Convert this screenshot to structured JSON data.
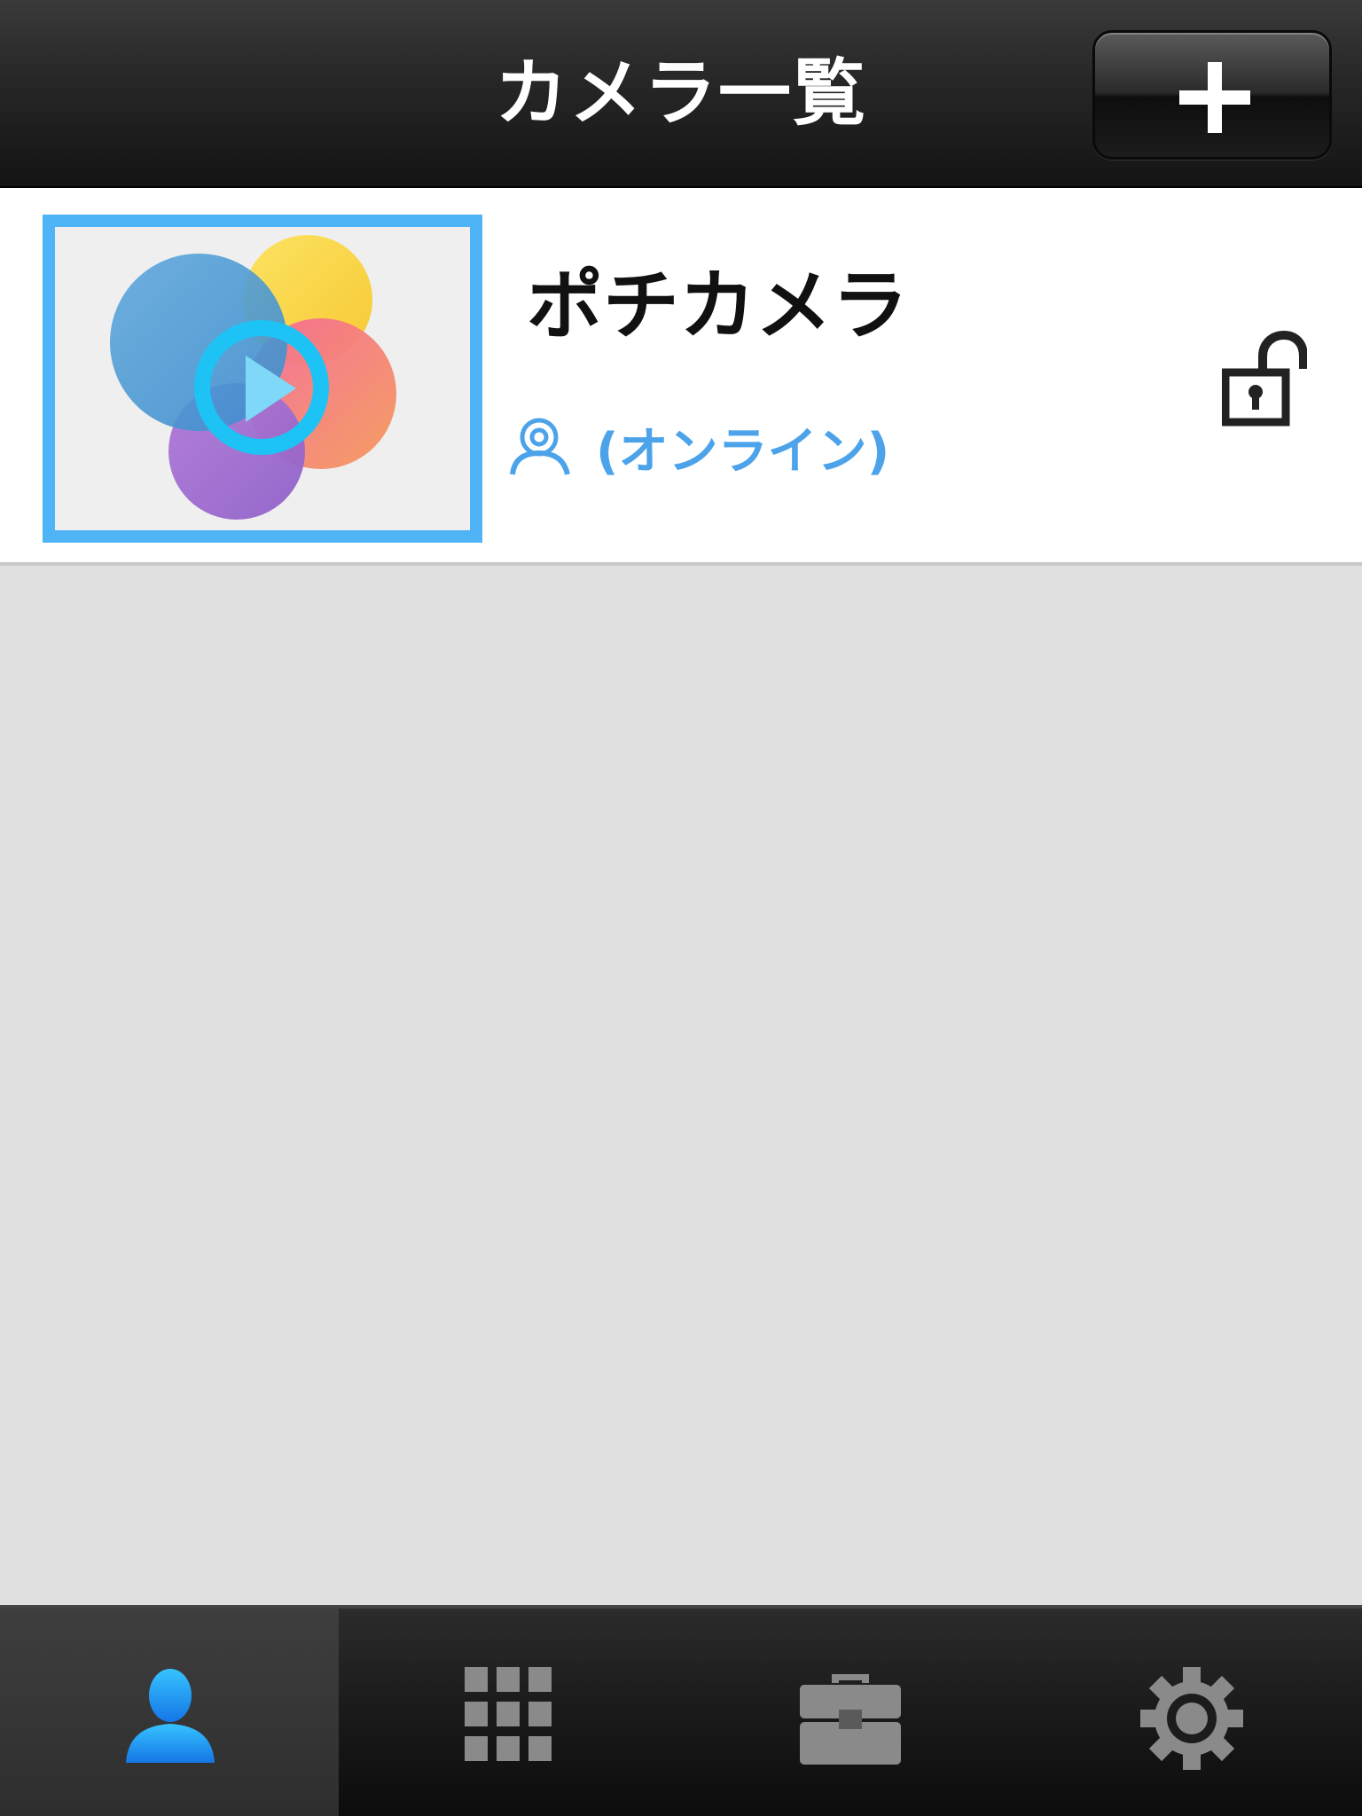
{
  "header": {
    "title": "カメラ一覧",
    "add_button_icon": "plus-icon"
  },
  "cameras": [
    {
      "name": "ポチカメラ",
      "status": "(オンライン)",
      "status_icon": "user-webcam-icon",
      "lock_icon": "unlocked-padlock-icon",
      "thumbnail_icon": "play-icon"
    }
  ],
  "tabs": [
    {
      "icon": "person-icon",
      "active": true
    },
    {
      "icon": "grid-icon",
      "active": false
    },
    {
      "icon": "toolbox-icon",
      "active": false
    },
    {
      "icon": "gear-icon",
      "active": false
    }
  ],
  "colors": {
    "accent": "#4da3ea",
    "thumbnail_border": "#4fb4f5",
    "active_tab_icon": "#1e90ff"
  }
}
